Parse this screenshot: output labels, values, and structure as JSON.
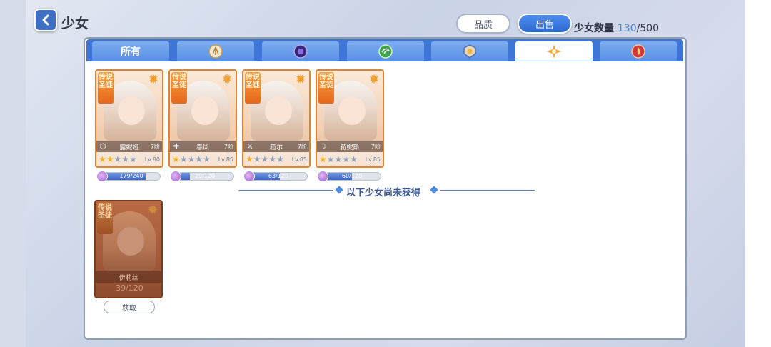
{
  "header": {
    "title": "少女",
    "quality_button": "品质",
    "sell_button": "出售",
    "count_label": "少女数量",
    "count_current": "130",
    "count_max": "/500"
  },
  "tabs": [
    {
      "label": "所有",
      "icon": "all",
      "active": false
    },
    {
      "label": "",
      "icon": "wing-emblem-icon",
      "active": false
    },
    {
      "label": "",
      "icon": "dark-emblem-icon",
      "active": false
    },
    {
      "label": "",
      "icon": "wind-emblem-icon",
      "active": false
    },
    {
      "label": "",
      "icon": "shield-emblem-icon",
      "active": false
    },
    {
      "label": "",
      "icon": "light-emblem-icon",
      "active": true
    },
    {
      "label": "",
      "icon": "fire-emblem-icon",
      "active": false
    }
  ],
  "owned_cards": [
    {
      "rank": "传说",
      "title": "圣徒",
      "name": "露妮娅",
      "stage": "7阶",
      "class_icon": "shield",
      "stars_on": 2,
      "stars_total": 5,
      "level": "Lv.80",
      "fragments": "179/240",
      "fragment_fraction": 0.75
    },
    {
      "rank": "传说",
      "title": "圣徒",
      "name": "春风",
      "stage": "7阶",
      "class_icon": "cross",
      "stars_on": 1,
      "stars_total": 5,
      "level": "Lv.85",
      "fragments": "29/120",
      "fragment_fraction": 0.24
    },
    {
      "rank": "传说",
      "title": "圣徒",
      "name": "菈尔",
      "stage": "7阶",
      "class_icon": "sword",
      "stars_on": 1,
      "stars_total": 5,
      "level": "Lv.85",
      "fragments": "63/120",
      "fragment_fraction": 0.53
    },
    {
      "rank": "传说",
      "title": "圣徒",
      "name": "菈妮斯",
      "stage": "7阶",
      "class_icon": "bow",
      "stars_on": 1,
      "stars_total": 5,
      "level": "Lv.85",
      "fragments": "60/120",
      "fragment_fraction": 0.5
    }
  ],
  "divider_text": "以下少女尚未获得",
  "locked_cards": [
    {
      "rank": "传说",
      "title": "圣徒",
      "name": "伊莉丝",
      "fragments": "39/120",
      "obtain_button": "获取"
    }
  ],
  "colors": {
    "accent": "#3e75d6",
    "card_border": "#e5822a",
    "star_on": "#f6b21c"
  }
}
